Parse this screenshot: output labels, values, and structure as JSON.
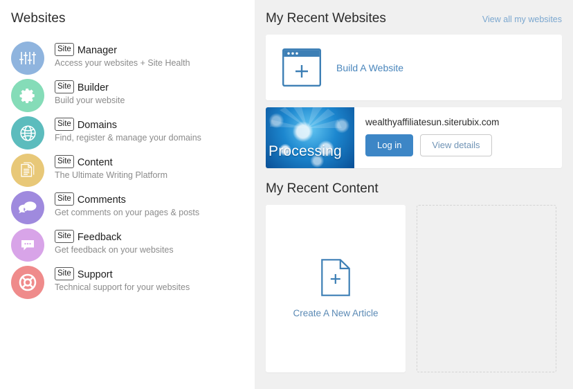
{
  "sidebar": {
    "title": "Websites",
    "items": [
      {
        "badge": "Site",
        "label": "Manager",
        "sub": "Access your websites + Site Health",
        "icon": "sliders-icon",
        "color": "#8fb4de"
      },
      {
        "badge": "Site",
        "label": "Builder",
        "sub": "Build your website",
        "icon": "gear-icon",
        "color": "#85dcb8"
      },
      {
        "badge": "Site",
        "label": "Domains",
        "sub": "Find, register & manage your domains",
        "icon": "globe-icon",
        "color": "#5cbcbd"
      },
      {
        "badge": "Site",
        "label": "Content",
        "sub": "The Ultimate Writing Platform",
        "icon": "documents-icon",
        "color": "#e8c878"
      },
      {
        "badge": "Site",
        "label": "Comments",
        "sub": "Get comments on your pages & posts",
        "icon": "chat-bubbles-icon",
        "color": "#9f8ade"
      },
      {
        "badge": "Site",
        "label": "Feedback",
        "sub": "Get feedback on your websites",
        "icon": "speech-dots-icon",
        "color": "#d8a4e8"
      },
      {
        "badge": "Site",
        "label": "Support",
        "sub": "Technical support for your websites",
        "icon": "life-ring-icon",
        "color": "#ef8b8b"
      }
    ]
  },
  "panel": {
    "title": "My Recent Websites",
    "view_all_link": "View all my websites",
    "build_card": {
      "label": "Build A Website",
      "icon": "browser-plus-icon"
    },
    "site": {
      "url": "wealthyaffiliatesun.siterubix.com",
      "thumb_label": "Processing",
      "login_button": "Log in",
      "details_button": "View details"
    },
    "content_section": {
      "title": "My Recent Content",
      "create_card": {
        "label": "Create A New Article",
        "icon": "document-plus-icon"
      },
      "placeholder_card": ""
    }
  },
  "colors": {
    "accent": "#3d86c6",
    "link": "#7ba7cf",
    "panel_bg": "#f0f0f0"
  }
}
